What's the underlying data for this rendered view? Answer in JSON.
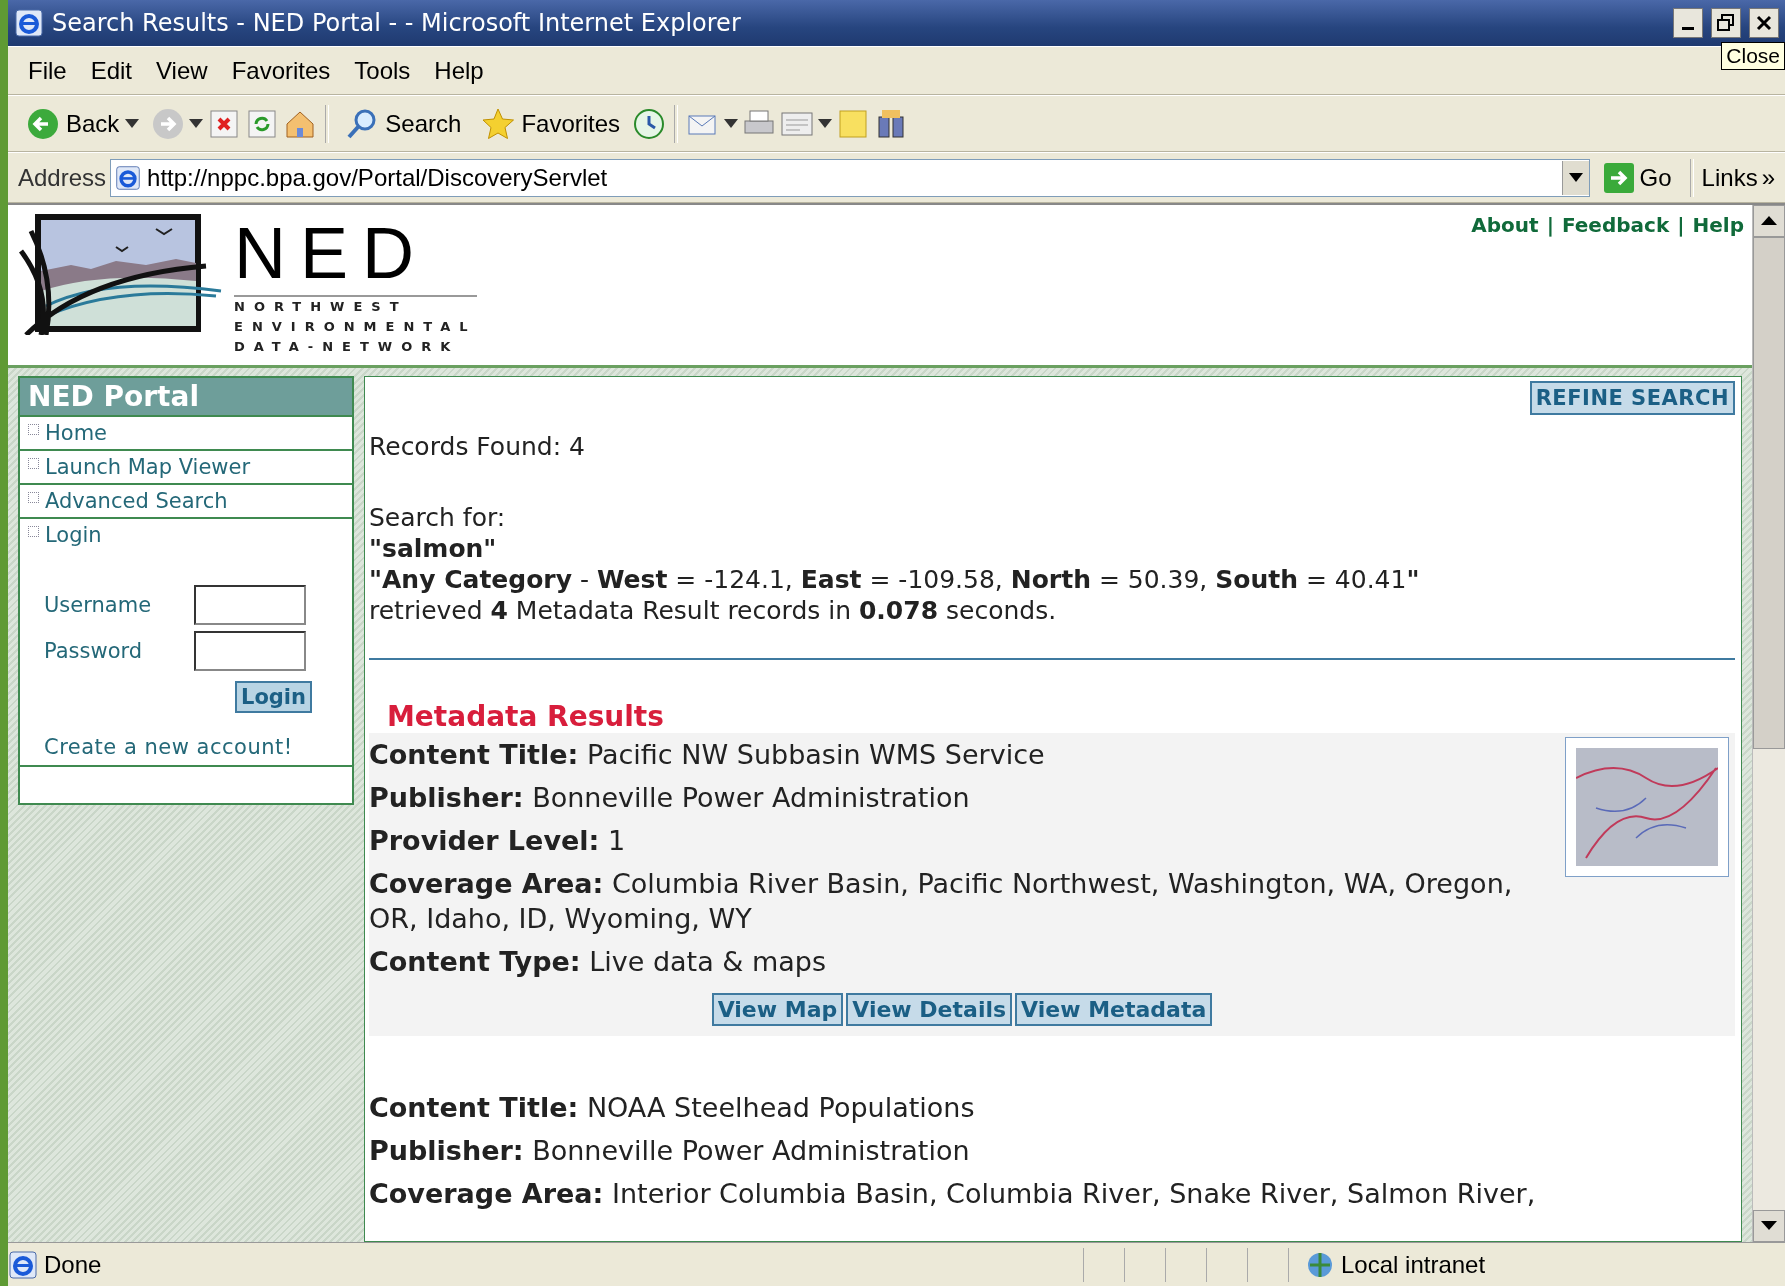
{
  "window": {
    "title": "Search Results - NED Portal - - Microsoft Internet Explorer",
    "tooltip": "Close"
  },
  "menu": [
    "File",
    "Edit",
    "View",
    "Favorites",
    "Tools",
    "Help"
  ],
  "toolbar": [
    {
      "kind": "back",
      "label": "Back"
    },
    {
      "kind": "forward"
    },
    {
      "kind": "stop"
    },
    {
      "kind": "refresh"
    },
    {
      "kind": "home"
    },
    {
      "kind": "search",
      "label": "Search"
    },
    {
      "kind": "favorites",
      "label": "Favorites"
    },
    {
      "kind": "history"
    },
    {
      "kind": "mail"
    },
    {
      "kind": "print"
    },
    {
      "kind": "edit"
    },
    {
      "kind": "notes"
    },
    {
      "kind": "research"
    }
  ],
  "address": {
    "label": "Address",
    "url": "http://nppc.bpa.gov/Portal/DiscoveryServlet",
    "go": "Go",
    "links": "Links",
    "more": "»"
  },
  "logo": {
    "name": "NED",
    "lines": [
      "NORTHWEST",
      "ENVIRONMENTAL",
      "DATA-NETWORK"
    ]
  },
  "header_links": [
    {
      "label": "About",
      "separator": "|"
    },
    {
      "label": "Feedback",
      "separator": "|"
    },
    {
      "label": "Help"
    }
  ],
  "sidebar": {
    "title": "NED Portal",
    "items": [
      "Home",
      "Launch Map Viewer",
      "Advanced Search",
      "Login"
    ],
    "login": {
      "username_label": "Username",
      "password_label": "Password",
      "button": "Login",
      "create_link": "Create a new account!"
    }
  },
  "results": {
    "refine_button": "REFINE SEARCH",
    "records_found": "Records Found: 4",
    "search_for_label": "Search for:",
    "query": "\"salmon\"",
    "extent": "**\"Any Category** - **West** = -124.1, **East** = -109.58, **North** = 50.39, **South** = 40.41**\"**",
    "retrieved": "retrieved **4** Metadata Result records in **0.078** seconds.",
    "section_title": "Metadata Results",
    "records": [
      {
        "shaded": true,
        "thumbnail": true,
        "fields": [
          {
            "label": "Content Title:",
            "value": "Pacific NW Subbasin WMS Service"
          },
          {
            "label": "Publisher:",
            "value": "Bonneville Power Administration"
          },
          {
            "label": "Provider Level:",
            "value": "1"
          },
          {
            "label": "Coverage Area:",
            "value": "Columbia River Basin, Pacific Northwest, Washington, WA, Oregon, OR, Idaho, ID, Wyoming, WY"
          },
          {
            "label": "Content Type:",
            "value": "Live data & maps"
          }
        ],
        "buttons": [
          "View Map",
          "View Details",
          "View Metadata"
        ]
      },
      {
        "shaded": false,
        "fields": [
          {
            "label": "Content Title:",
            "value": "NOAA Steelhead Populations"
          },
          {
            "label": "Publisher:",
            "value": "Bonneville Power Administration"
          },
          {
            "label": "Coverage Area:",
            "value": "Interior Columbia Basin, Columbia River, Snake River, Salmon River,"
          }
        ]
      }
    ]
  },
  "status": {
    "text": "Done",
    "zone": "Local intranet"
  }
}
